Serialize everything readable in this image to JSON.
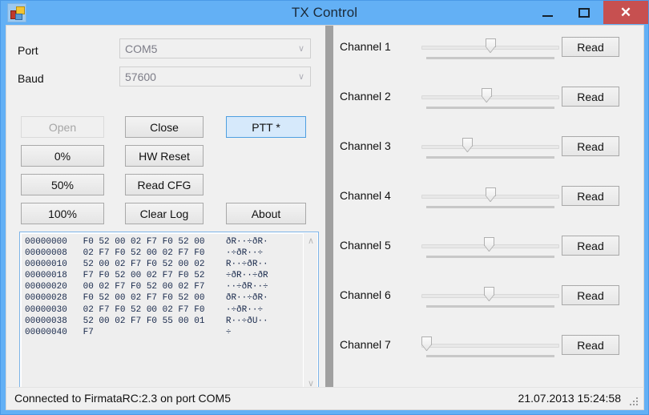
{
  "window": {
    "title": "TX Control",
    "icon": "app-icon",
    "minimize": "–",
    "maximize": "□",
    "close": "✕",
    "close_color": "#c75050",
    "titlebar_color": "#63b0f5"
  },
  "left_panel": {
    "port": {
      "label": "Port",
      "value": "COM5",
      "chevron": "∨"
    },
    "baud": {
      "label": "Baud",
      "value": "57600",
      "chevron": "∨"
    },
    "buttons": {
      "open": "Open",
      "close": "Close",
      "ptt": "PTT *",
      "pct0": "0%",
      "hw_reset": "HW Reset",
      "pct50": "50%",
      "read_cfg": "Read CFG",
      "pct100": "100%",
      "clear_log": "Clear Log",
      "about": "About"
    },
    "accent_color": "#4f9fe0"
  },
  "log": {
    "lines": [
      "00000000   F0 52 00 02 F7 F0 52 00    ðR··÷ðR·",
      "00000008   02 F7 F0 52 00 02 F7 F0    ·÷ðR··÷",
      "00000010   52 00 02 F7 F0 52 00 02    R··÷ðR··",
      "00000018   F7 F0 52 00 02 F7 F0 52    ÷ðR··÷ðR",
      "00000020   00 02 F7 F0 52 00 02 F7    ··÷ðR··÷",
      "00000028   F0 52 00 02 F7 F0 52 00    ðR··÷ðR·",
      "00000030   02 F7 F0 52 00 02 F7 F0    ·÷ðR··÷",
      "00000038   52 00 02 F7 F0 55 00 01    R··÷ðU··",
      "00000040   F7                         ÷"
    ],
    "scroll_up": "∧",
    "scroll_down": "∨",
    "scroll_left": "‹",
    "scroll_right": "›"
  },
  "channels": [
    {
      "label": "Channel 1",
      "read": "Read",
      "value": 50
    },
    {
      "label": "Channel 2",
      "read": "Read",
      "value": 47
    },
    {
      "label": "Channel 3",
      "read": "Read",
      "value": 32
    },
    {
      "label": "Channel 4",
      "read": "Read",
      "value": 50
    },
    {
      "label": "Channel 5",
      "read": "Read",
      "value": 49
    },
    {
      "label": "Channel 6",
      "read": "Read",
      "value": 49
    },
    {
      "label": "Channel 7",
      "read": "Read",
      "value": 0
    }
  ],
  "status": {
    "message": "Connected to FirmataRC:2.3 on port COM5",
    "timestamp": "21.07.2013 15:24:58"
  }
}
